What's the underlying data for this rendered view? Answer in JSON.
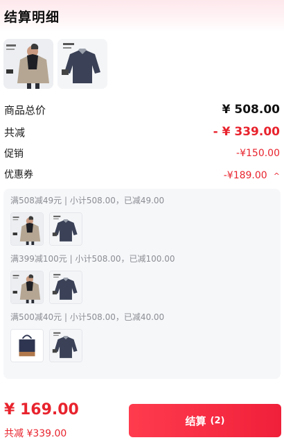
{
  "header": {
    "title": "结算明细"
  },
  "products": [
    {
      "icon": "jacket-product-image"
    },
    {
      "icon": "sweater-product-image"
    }
  ],
  "summary": {
    "subtotal_label": "商品总价",
    "subtotal_value": "¥ 508.00",
    "discount_label": "共减",
    "discount_value": "- ¥ 339.00",
    "promo_label": "促销",
    "promo_value": "-¥150.00",
    "coupon_label": "优惠券",
    "coupon_value": "-¥189.00",
    "coupon_caret": "^"
  },
  "coupon_groups": [
    {
      "text": "满508减49元 | 小计508.00，已减49.00",
      "items": [
        "jacket",
        "sweater"
      ]
    },
    {
      "text": "满399减100元 | 小计508.00，已减100.00",
      "items": [
        "jacket",
        "sweater"
      ]
    },
    {
      "text": "满500减40元 | 小计508.00，已减40.00",
      "items": [
        "tote-bag",
        "sweater"
      ]
    }
  ],
  "footer": {
    "total": "¥ 169.00",
    "saved": "共减 ¥339.00",
    "pay_label": "结算",
    "pay_count": "(2)"
  },
  "colors": {
    "accent": "#e8232d",
    "button": "#f0203a"
  }
}
